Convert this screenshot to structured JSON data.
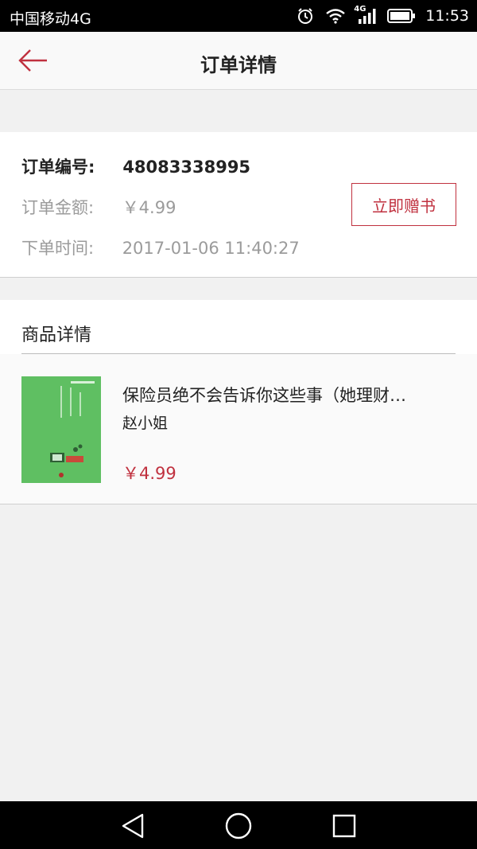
{
  "status_bar": {
    "carrier": "中国移动4G",
    "network_badge": "4G",
    "time": "11:53"
  },
  "header": {
    "title": "订单详情"
  },
  "order": {
    "id_label": "订单编号:",
    "id_value": "48083338995",
    "amount_label": "订单金额:",
    "amount_value": "￥4.99",
    "time_label": "下单时间:",
    "time_value": "2017-01-06 11:40:27",
    "gift_button": "立即赠书"
  },
  "goods": {
    "section_title": "商品详情",
    "item": {
      "title": "保险员绝不会告诉你这些事（她理财…",
      "author": "赵小姐",
      "price": "￥4.99"
    }
  },
  "colors": {
    "accent": "#c0313f",
    "muted_text": "#9b9b9b",
    "cover_green": "#5fbf62"
  }
}
